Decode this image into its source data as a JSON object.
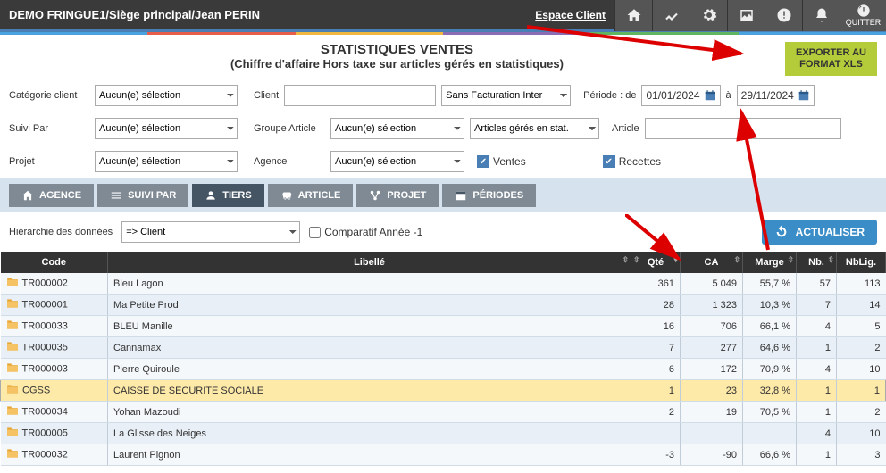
{
  "topbar": {
    "title": "DEMO FRINGUE1/Siège principal/Jean PERIN",
    "espace_client": "Espace Client",
    "quitter": "QUITTER"
  },
  "header": {
    "title": "STATISTIQUES VENTES",
    "subtitle": "(Chiffre d'affaire Hors taxe sur articles gérés en statistiques)",
    "export_l1": "EXPORTER AU",
    "export_l2": "FORMAT XLS"
  },
  "filters": {
    "categorie_client_label": "Catégorie client",
    "categorie_client_value": "Aucun(e) sélection",
    "client_label": "Client",
    "client_value": "",
    "facturation_value": "Sans Facturation Inter",
    "periode_label": "Période : de",
    "date_from": "01/01/2024",
    "a_label": "à",
    "date_to": "29/11/2024",
    "suivi_par_label": "Suivi Par",
    "suivi_par_value": "Aucun(e) sélection",
    "groupe_article_label": "Groupe Article",
    "groupe_article_value": "Aucun(e) sélection",
    "gestion_stat_value": "Articles gérés en stat.",
    "article_label": "Article",
    "article_value": "",
    "projet_label": "Projet",
    "projet_value": "Aucun(e) sélection",
    "agence_label": "Agence",
    "agence_value": "Aucun(e) sélection",
    "ventes_label": "Ventes",
    "recettes_label": "Recettes"
  },
  "tabs": {
    "agence": "AGENCE",
    "suivi_par": "SUIVI PAR",
    "tiers": "TIERS",
    "article": "ARTICLE",
    "projet": "PROJET",
    "periodes": "PÉRIODES"
  },
  "hierarchy": {
    "label": "Hiérarchie des données",
    "value": "=> Client",
    "comparatif_label": "Comparatif Année -1",
    "actualiser": "ACTUALISER"
  },
  "table": {
    "headers": {
      "code": "Code",
      "libelle": "Libellé",
      "qte": "Qté",
      "ca": "CA",
      "marge": "Marge",
      "nb": "Nb.",
      "nblig": "NbLig."
    },
    "rows": [
      {
        "code": "TR000002",
        "libelle": "Bleu Lagon",
        "qte": "361",
        "ca": "5 049",
        "marge": "55,7 %",
        "nb": "57",
        "nblig": "113"
      },
      {
        "code": "TR000001",
        "libelle": "Ma Petite Prod",
        "qte": "28",
        "ca": "1 323",
        "marge": "10,3 %",
        "nb": "7",
        "nblig": "14"
      },
      {
        "code": "TR000033",
        "libelle": "BLEU Manille",
        "qte": "16",
        "ca": "706",
        "marge": "66,1 %",
        "nb": "4",
        "nblig": "5"
      },
      {
        "code": "TR000035",
        "libelle": "Cannamax",
        "qte": "7",
        "ca": "277",
        "marge": "64,6 %",
        "nb": "1",
        "nblig": "2"
      },
      {
        "code": "TR000003",
        "libelle": "Pierre Quiroule",
        "qte": "6",
        "ca": "172",
        "marge": "70,9 %",
        "nb": "4",
        "nblig": "10"
      },
      {
        "code": "CGSS",
        "libelle": "CAISSE DE SECURITE SOCIALE",
        "qte": "1",
        "ca": "23",
        "marge": "32,8 %",
        "nb": "1",
        "nblig": "1",
        "selected": true
      },
      {
        "code": "TR000034",
        "libelle": "Yohan Mazoudi",
        "qte": "2",
        "ca": "19",
        "marge": "70,5 %",
        "nb": "1",
        "nblig": "2"
      },
      {
        "code": "TR000005",
        "libelle": "La Glisse des Neiges",
        "qte": "",
        "ca": "",
        "marge": "",
        "nb": "4",
        "nblig": "10"
      },
      {
        "code": "TR000032",
        "libelle": "Laurent Pignon",
        "qte": "-3",
        "ca": "-90",
        "marge": "66,6 %",
        "nb": "1",
        "nblig": "3"
      }
    ]
  }
}
